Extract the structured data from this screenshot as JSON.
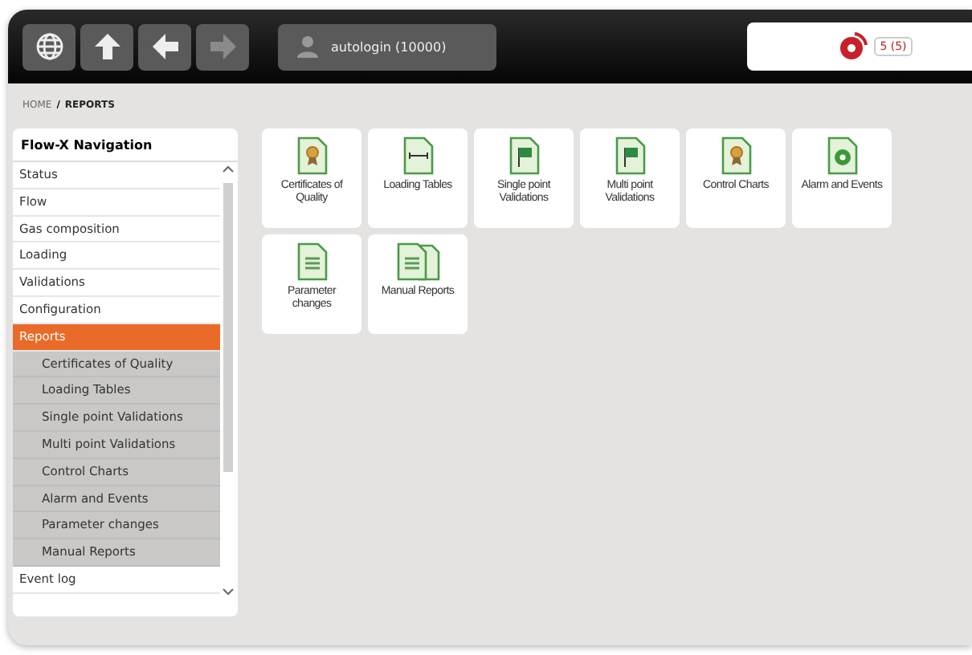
{
  "toolbar": {
    "user": "autologin (10000)",
    "alarm_count": "5 (5)"
  },
  "breadcrumb": {
    "home": "HOME",
    "separator": "/",
    "current": "REPORTS"
  },
  "sidebar": {
    "title": "Flow-X Navigation",
    "items": [
      {
        "label": "Status",
        "selected": false
      },
      {
        "label": "Flow",
        "selected": false
      },
      {
        "label": "Gas composition",
        "selected": false
      },
      {
        "label": "Loading",
        "selected": false
      },
      {
        "label": "Validations",
        "selected": false
      },
      {
        "label": "Configuration",
        "selected": false
      },
      {
        "label": "Reports",
        "selected": true,
        "children": [
          {
            "label": "Certificates of Quality"
          },
          {
            "label": "Loading Tables"
          },
          {
            "label": "Single point Validations"
          },
          {
            "label": "Multi point Validations"
          },
          {
            "label": "Control Charts"
          },
          {
            "label": "Alarm and Events"
          },
          {
            "label": "Parameter changes"
          },
          {
            "label": "Manual Reports"
          }
        ]
      },
      {
        "label": "Event log",
        "selected": false
      }
    ]
  },
  "tiles": [
    {
      "label": "Certificates of Quality",
      "kind": "certificate"
    },
    {
      "label": "Loading Tables",
      "kind": "table"
    },
    {
      "label": "Single point Validations",
      "kind": "flag"
    },
    {
      "label": "Multi point Validations",
      "kind": "flag"
    },
    {
      "label": "Control Charts",
      "kind": "certificate"
    },
    {
      "label": "Alarm and Events",
      "kind": "alarm"
    },
    {
      "label": "Parameter changes",
      "kind": "document"
    },
    {
      "label": "Manual Reports",
      "kind": "documents"
    }
  ]
}
